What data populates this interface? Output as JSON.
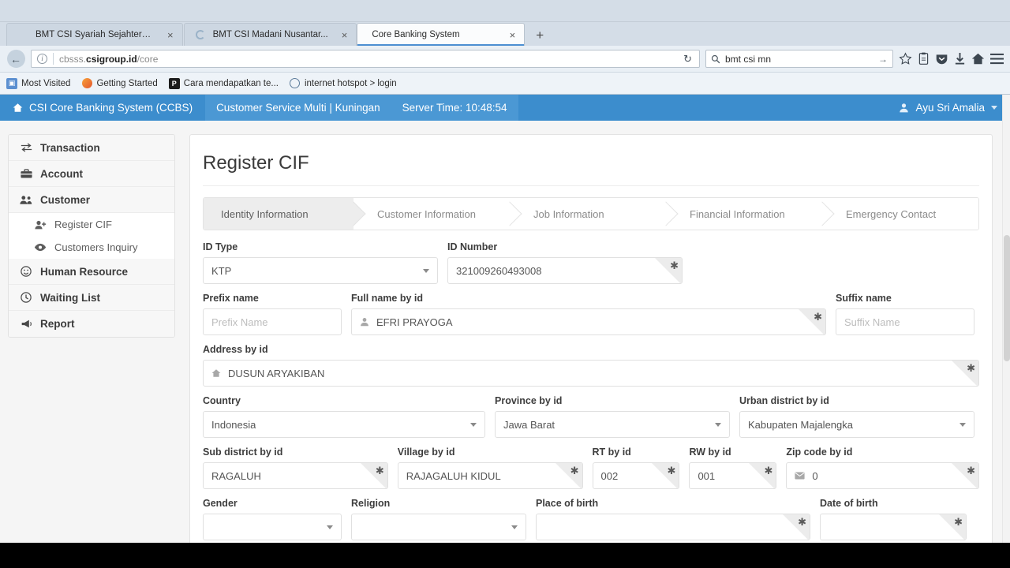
{
  "browser": {
    "tabs": [
      {
        "title": "BMT CSI Syariah Sejahtera | Me...",
        "close": "×",
        "active": false,
        "favicon": "page-icon"
      },
      {
        "title": "BMT CSI Madani Nusantar...",
        "close": "×",
        "active": false,
        "favicon": "loading-spinner-icon"
      },
      {
        "title": "Core Banking System",
        "close": "×",
        "active": true,
        "favicon": "none"
      }
    ],
    "new_tab_label": "+",
    "nav": {
      "back": "←",
      "info_icon": "i",
      "url_host_dim": "cbsss.",
      "url_host_strong": "csigroup.id",
      "url_path": "/core",
      "reload": "↻",
      "search_value": "bmt csi mn",
      "search_go": "→",
      "icons": [
        "search-icon",
        "bookmark-star-icon",
        "reader-icon",
        "pocket-icon",
        "downloads-icon",
        "home-icon",
        "menu-icon"
      ]
    },
    "bookmarks": [
      {
        "label": "Most Visited",
        "icon": "most-visited-icon"
      },
      {
        "label": "Getting Started",
        "icon": "firefox-icon"
      },
      {
        "label": "Cara mendapatkan te...",
        "icon": "pocket-p-icon"
      },
      {
        "label": "internet hotspot > login",
        "icon": "globe-icon"
      }
    ]
  },
  "appbar": {
    "brand": "CSI Core Banking System (CCBS)",
    "brand_icon": "home-icon",
    "branch": "Customer Service Multi | Kuningan",
    "server_time": "Server Time: 10:48:54",
    "user": "Ayu Sri Amalia",
    "user_icon": "user-icon",
    "accent_color": "#3c8dcd"
  },
  "sidebar": {
    "items": [
      {
        "label": "Transaction",
        "icon": "exchange-icon",
        "sub": []
      },
      {
        "label": "Account",
        "icon": "briefcase-icon",
        "sub": []
      },
      {
        "label": "Customer",
        "icon": "users-icon",
        "sub": [
          {
            "label": "Register CIF",
            "icon": "user-plus-icon"
          },
          {
            "label": "Customers Inquiry",
            "icon": "eye-icon"
          }
        ]
      },
      {
        "label": "Human Resource",
        "icon": "smiley-icon",
        "sub": []
      },
      {
        "label": "Waiting List",
        "icon": "clock-icon",
        "sub": []
      },
      {
        "label": "Report",
        "icon": "megaphone-icon",
        "sub": []
      }
    ]
  },
  "main": {
    "title": "Register CIF",
    "steps": [
      {
        "label": "Identity Information",
        "active": true
      },
      {
        "label": "Customer Information",
        "active": false
      },
      {
        "label": "Job Information",
        "active": false
      },
      {
        "label": "Financial Information",
        "active": false
      },
      {
        "label": "Emergency Contact",
        "active": false
      }
    ],
    "required_marker": "✱",
    "fields": {
      "id_type": {
        "label": "ID Type",
        "value": "KTP",
        "type": "select",
        "required": false
      },
      "id_number": {
        "label": "ID Number",
        "value": "321009260493008",
        "type": "text",
        "required": true
      },
      "prefix_name": {
        "label": "Prefix name",
        "value": "",
        "placeholder": "Prefix Name",
        "type": "text",
        "required": false
      },
      "full_name": {
        "label": "Full name by id",
        "value": "EFRI PRAYOGA",
        "type": "text",
        "required": true,
        "icon": "user-icon"
      },
      "suffix_name": {
        "label": "Suffix name",
        "value": "",
        "placeholder": "Suffix Name",
        "type": "text",
        "required": false
      },
      "address": {
        "label": "Address by id",
        "value": "DUSUN ARYAKIBAN",
        "type": "text",
        "required": true,
        "icon": "home-icon"
      },
      "country": {
        "label": "Country",
        "value": "Indonesia",
        "type": "select",
        "required": false
      },
      "province": {
        "label": "Province by id",
        "value": "Jawa Barat",
        "type": "select",
        "required": false
      },
      "urban_district": {
        "label": "Urban district by id",
        "value": "Kabupaten Majalengka",
        "type": "select",
        "required": false
      },
      "sub_district": {
        "label": "Sub district by id",
        "value": "RAGALUH",
        "type": "text",
        "required": true
      },
      "village": {
        "label": "Village by id",
        "value": "RAJAGALUH KIDUL",
        "type": "text",
        "required": true
      },
      "rt": {
        "label": "RT by id",
        "value": "002",
        "type": "text",
        "required": true
      },
      "rw": {
        "label": "RW by id",
        "value": "001",
        "type": "text",
        "required": true
      },
      "zip_code": {
        "label": "Zip code by id",
        "value": "0",
        "type": "text",
        "required": true,
        "icon": "envelope-icon"
      },
      "gender": {
        "label": "Gender",
        "value": "",
        "type": "select",
        "required": false
      },
      "religion": {
        "label": "Religion",
        "value": "",
        "type": "select",
        "required": false
      },
      "place_of_birth": {
        "label": "Place of birth",
        "value": "",
        "type": "text",
        "required": true
      },
      "date_of_birth": {
        "label": "Date of birth",
        "value": "",
        "type": "text",
        "required": true
      }
    }
  }
}
